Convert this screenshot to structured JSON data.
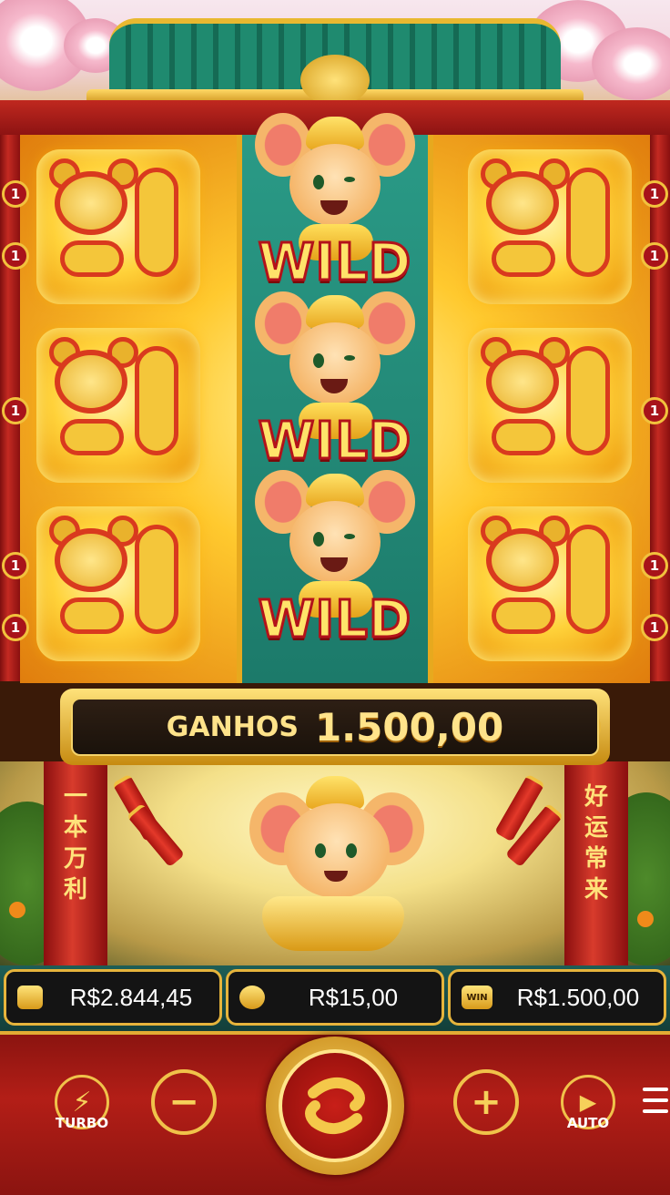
{
  "reel_badges": {
    "left": [
      "1",
      "1",
      "1",
      "1",
      "1"
    ],
    "right": [
      "1",
      "1",
      "1",
      "1",
      "1"
    ]
  },
  "wild_symbols": [
    "WILD",
    "WILD",
    "WILD"
  ],
  "win_banner": {
    "label": "GANHOS",
    "amount": "1.500,00"
  },
  "pillars": {
    "left_text": [
      "一",
      "本",
      "万",
      "利"
    ],
    "right_text": [
      "好",
      "运",
      "常",
      "来"
    ]
  },
  "stats": {
    "balance": {
      "icon": "wallet-icon",
      "value": "R$2.844,45"
    },
    "bet": {
      "icon": "coins-icon",
      "value": "R$15,00"
    },
    "win": {
      "icon": "win-icon",
      "icon_text": "WIN",
      "value": "R$1.500,00"
    }
  },
  "controls": {
    "turbo_label": "TURBO",
    "auto_label": "AUTO",
    "minus_symbol": "−",
    "plus_symbol": "+"
  },
  "colors": {
    "accent_gold": "#f0c24a",
    "panel_red": "#b31e17",
    "reel_teal": "#1c7a6a"
  }
}
